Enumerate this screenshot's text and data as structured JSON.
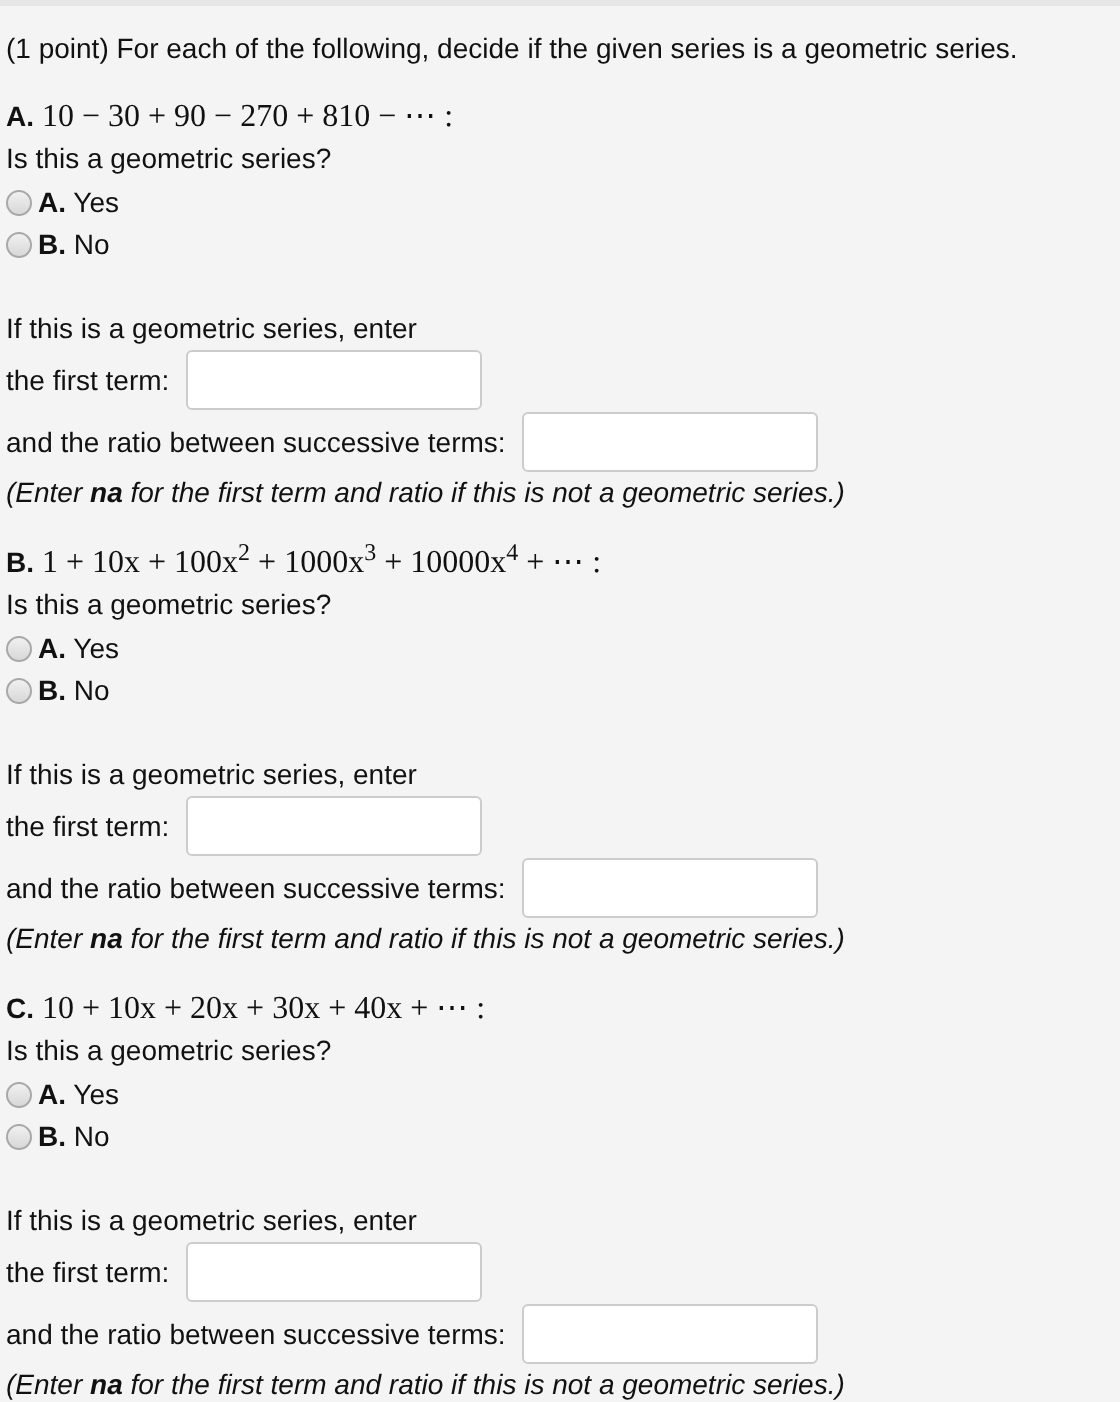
{
  "intro": "(1 point) For each of the following, decide if the given series is a geometric series.",
  "parts": [
    {
      "label": "A.",
      "expression": "10 − 30 + 90 − 270 + 810 − ⋯ :",
      "question": "Is this a geometric series?",
      "choices": [
        {
          "text": "**A.** Yes",
          "selected": false
        },
        {
          "text": "**B.** No",
          "selected": false
        }
      ],
      "prompt": "If this is a geometric series, enter",
      "first_term_label": "the first term:",
      "ratio_label": "and the ratio between successive terms:",
      "note": "(Enter **na** for the first term and ratio if this is not a geometric series.)"
    },
    {
      "label": "B.",
      "expression": "1 + 10x + 100x$^{2}$ + 1000x$^{3}$ + 10000x$^{4}$ + ⋯ :",
      "question": "Is this a geometric series?",
      "choices": [
        {
          "text": "**A.** Yes",
          "selected": false
        },
        {
          "text": "**B.** No",
          "selected": false
        }
      ],
      "prompt": "If this is a geometric series, enter",
      "first_term_label": "the first term:",
      "ratio_label": "and the ratio between successive terms:",
      "note": "(Enter **na** for the first term and ratio if this is not a geometric series.)"
    },
    {
      "label": "C.",
      "expression": "10 + 10x + 20x + 30x + 40x + ⋯ :",
      "question": "Is this a geometric series?",
      "choices": [
        {
          "text": "**A.** Yes",
          "selected": false
        },
        {
          "text": "**B.** No",
          "selected": false
        }
      ],
      "prompt": "If this is a geometric series, enter",
      "first_term_label": "the first term:",
      "ratio_label": "and the ratio between successive terms:",
      "note": "(Enter **na** for the first term and ratio if this is not a geometric series.)"
    }
  ]
}
